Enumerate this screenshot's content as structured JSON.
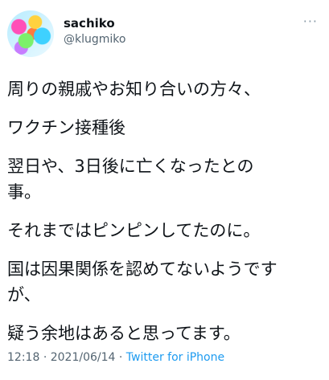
{
  "tweet": {
    "display_name": "sachiko",
    "handle": "@klugmiko",
    "more_icon": "more-horizontal-icon",
    "lines": [
      "周りの親戚やお知り合いの方々、",
      "ワクチン接種後",
      "翌日や、3日後に亡くなったとの",
      "事。",
      "それまではピンピンしてたのに。",
      "国は因果関係を認めてないようです",
      "が、",
      "疑う余地はあると思ってます。"
    ],
    "time": "12:18",
    "separator": "·",
    "date": "2021/06/14",
    "source": "Twitter for iPhone"
  },
  "colors": {
    "text": "#0f1419",
    "secondary": "#536471",
    "link": "#1d9bf0",
    "background": "#ffffff"
  }
}
